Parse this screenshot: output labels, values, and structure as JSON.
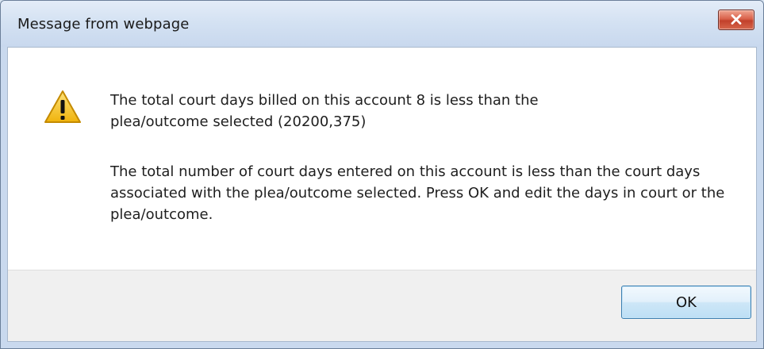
{
  "dialog": {
    "title": "Message from webpage",
    "close_icon": "close-x-icon",
    "warning_icon": "warning-triangle-icon",
    "message_line1": "The total court days billed on this account 8 is less than the plea/outcome selected (20200,375)",
    "message_line2": "The total number of court days entered on this account is less than the court days associated with the plea/outcome selected. Press OK and edit the days in court or the plea/outcome.",
    "ok_label": "OK"
  },
  "colors": {
    "close_button": "#c2412b",
    "titlebar": "#d3e1f2",
    "ok_border": "#3c7fb1",
    "warning_fill": "#f5c518"
  }
}
